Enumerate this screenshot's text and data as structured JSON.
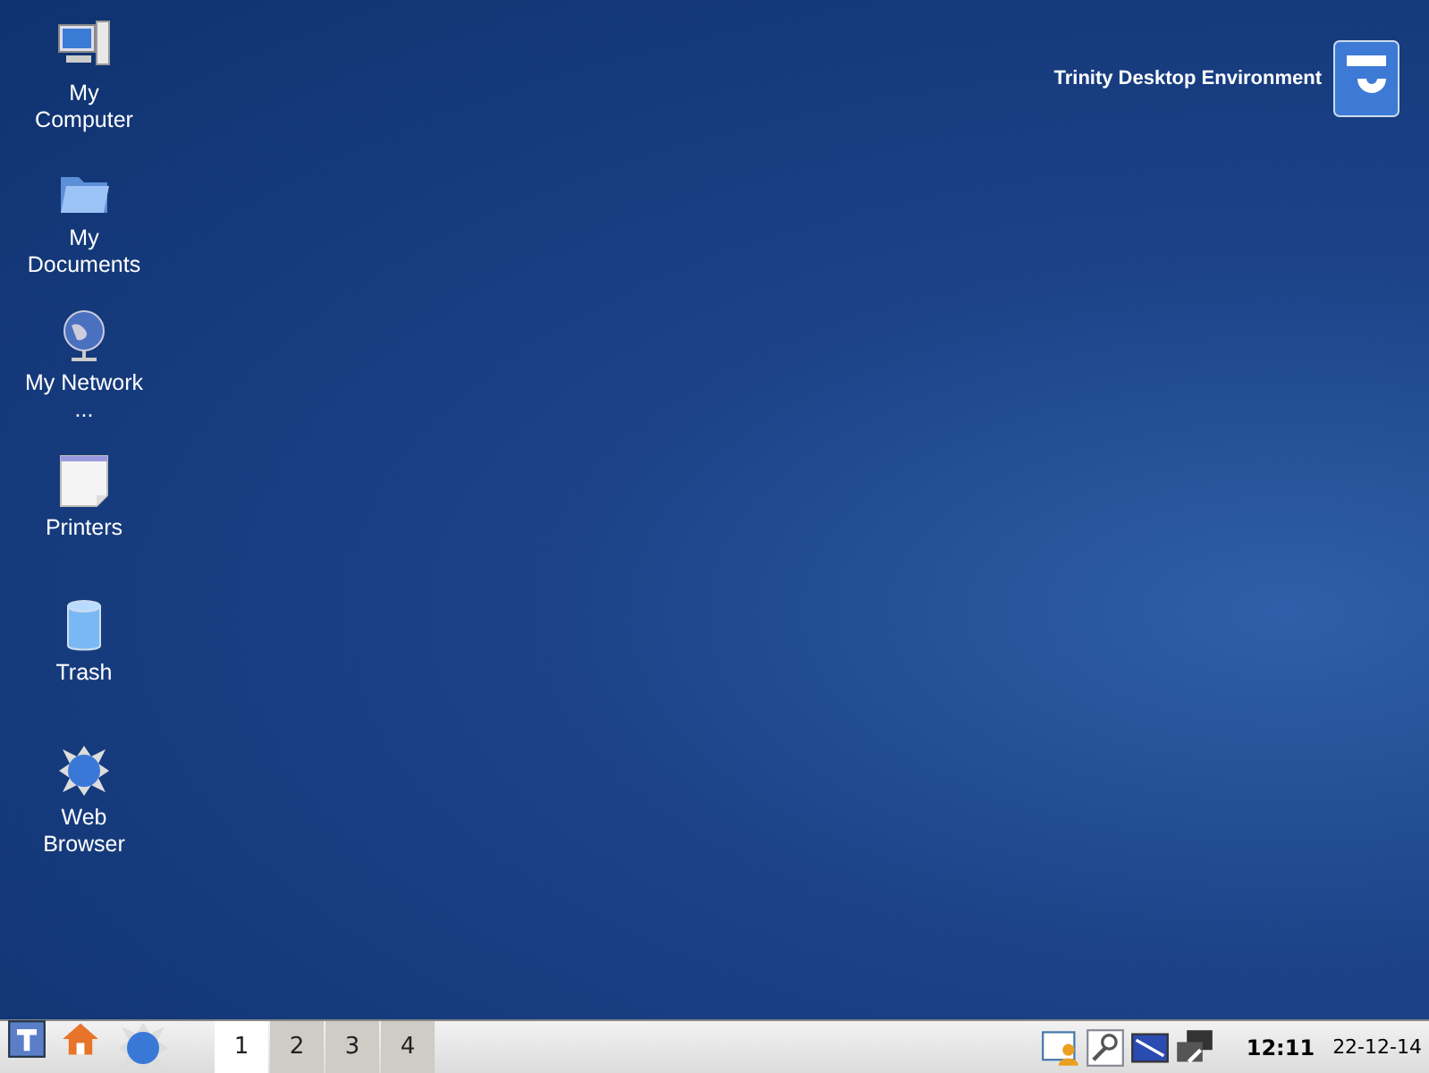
{
  "desktop": {
    "icons": [
      {
        "kind": "computer",
        "label": "My Computer"
      },
      {
        "kind": "documents",
        "label": "My Documents"
      },
      {
        "kind": "network",
        "label": "My Network ..."
      },
      {
        "kind": "printers",
        "label": "Printers"
      },
      {
        "kind": "trash",
        "label": "Trash"
      },
      {
        "kind": "browser",
        "label": "Web Browser"
      }
    ],
    "branding": {
      "text": "Trinity Desktop Environment"
    }
  },
  "taskbar": {
    "launchers": [
      {
        "kind": "menu"
      },
      {
        "kind": "home"
      },
      {
        "kind": "browser"
      }
    ],
    "desktops": [
      {
        "label": "1",
        "selected": true
      },
      {
        "label": "2",
        "selected": false
      },
      {
        "label": "3",
        "selected": false
      },
      {
        "label": "4",
        "selected": false
      }
    ],
    "tray": [
      {
        "kind": "contacts"
      },
      {
        "kind": "search"
      },
      {
        "kind": "display"
      },
      {
        "kind": "network"
      }
    ],
    "clock": {
      "time": "12:11",
      "date": "22-12-14"
    }
  }
}
